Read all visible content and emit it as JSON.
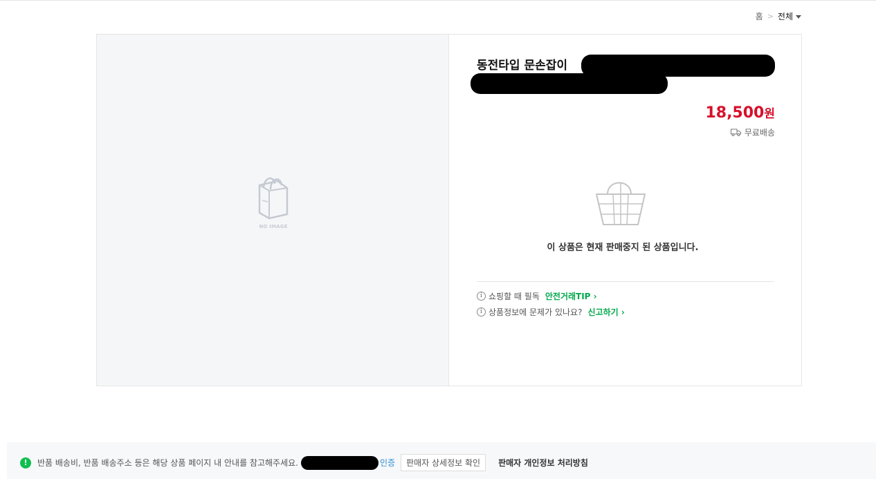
{
  "breadcrumb": {
    "home": "홈",
    "separator": ">",
    "current": "전체"
  },
  "product": {
    "title": "동전타입 문손잡이",
    "price": "18,500",
    "currency": "원",
    "shipping": "무료배송",
    "no_image_label": "NO IMAGE",
    "soldout_message": "이 상품은 현재 판매중지 된 상품입니다."
  },
  "tips": [
    {
      "text": "쇼핑할 때 필독",
      "link": "안전거래TIP"
    },
    {
      "text": "상품정보에 문제가 있나요?",
      "link": "신고하기"
    }
  ],
  "footer": {
    "notice": "반품 배송비, 반품 배송주소 등은 해당 상품 페이지 내 안내를 참고해주세요.",
    "cert_label": "인증",
    "seller_detail_button": "판매자 상세정보 확인",
    "privacy_link": "판매자 개인정보 처리방침"
  },
  "colors": {
    "price": "#d7102c",
    "link_green": "#03a94d",
    "alert_green": "#0ebf4f",
    "cert_blue": "#2a8bd6"
  },
  "icons": [
    "chevron-down-icon",
    "no-image-bag-icon",
    "truck-icon",
    "basket-icon",
    "info-icon",
    "chevron-right-icon",
    "alert-icon"
  ]
}
